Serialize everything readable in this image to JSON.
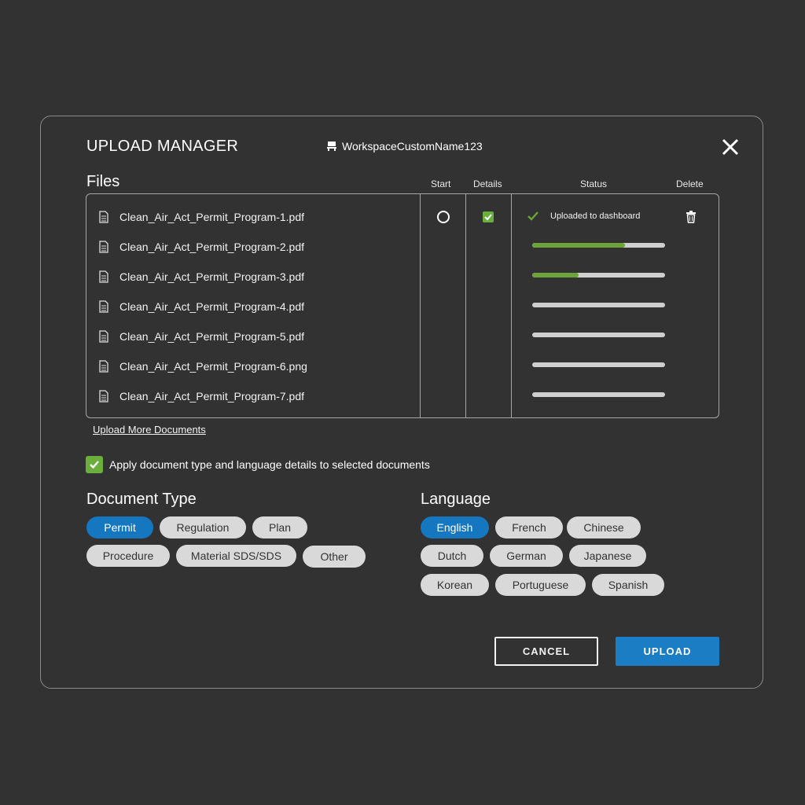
{
  "header": {
    "title": "UPLOAD MANAGER",
    "workspace": "WorkspaceCustomName123",
    "workspace_icon": "workspace-icon",
    "close_icon": "close-icon"
  },
  "files_section": {
    "label": "Files",
    "columns": {
      "start": "Start",
      "details": "Details",
      "status": "Status",
      "delete": "Delete"
    },
    "files": [
      {
        "name": "Clean_Air_Act_Permit_Program-1.pdf",
        "status_text": "Uploaded to dashboard",
        "progress": 1.0
      },
      {
        "name": "Clean_Air_Act_Permit_Program-2.pdf",
        "progress": 0.7
      },
      {
        "name": "Clean_Air_Act_Permit_Program-3.pdf",
        "progress": 0.35
      },
      {
        "name": "Clean_Air_Act_Permit_Program-4.pdf",
        "progress": 0
      },
      {
        "name": "Clean_Air_Act_Permit_Program-5.pdf",
        "progress": 0
      },
      {
        "name": "Clean_Air_Act_Permit_Program-6.png",
        "progress": 0
      },
      {
        "name": "Clean_Air_Act_Permit_Program-7.pdf",
        "progress": 0
      }
    ],
    "upload_more": "Upload More Documents"
  },
  "apply_details": {
    "label": "Apply document type and language details to selected documents",
    "checked": true
  },
  "document_type": {
    "label": "Document Type",
    "options": [
      "Permit",
      "Regulation",
      "Plan",
      "Procedure",
      "Material SDS/SDS",
      "Other"
    ],
    "selected": "Permit"
  },
  "language": {
    "label": "Language",
    "options": [
      "English",
      "French",
      "Chinese",
      "Dutch",
      "German",
      "Japanese",
      "Korean",
      "Portuguese",
      "Spanish"
    ],
    "selected": "English"
  },
  "actions": {
    "cancel": "CANCEL",
    "upload": "UPLOAD"
  },
  "colors": {
    "background": "#323232",
    "accent_blue": "#1477c0",
    "progress_green": "#6ea33a",
    "check_green": "#6aaf3c"
  }
}
